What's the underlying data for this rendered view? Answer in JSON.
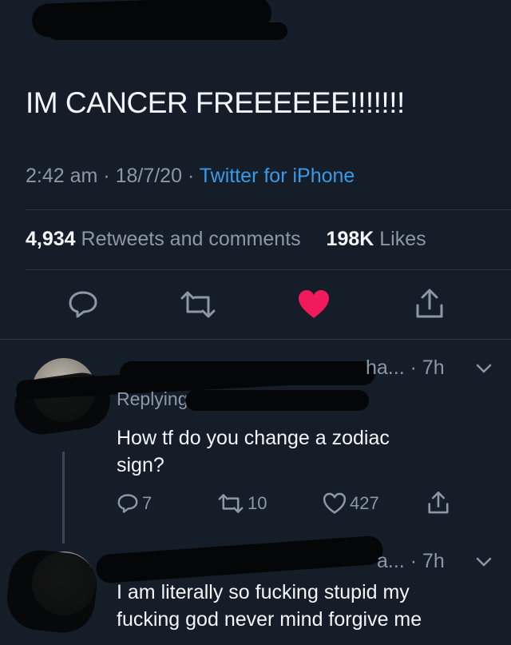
{
  "tweet": {
    "handle_partial": "@…",
    "text": "IM CANCER FREEEEEE!!!!!!!",
    "time": "2:42 am",
    "date": "18/7/20",
    "source": "Twitter for iPhone",
    "retweets_count": "4,934",
    "retweets_label": "Retweets and comments",
    "likes_count": "198K",
    "likes_label": "Likes",
    "liked": true,
    "colors": {
      "link": "#3b9ae8",
      "like": "#f01a5c",
      "muted": "#8a98a7",
      "background": "#151d28"
    }
  },
  "replies": [
    {
      "name_partial": "ha...",
      "age": "· 7h",
      "replying_label": "Replying to",
      "text_line1": "How tf do you change a zodiac",
      "text_line2": "sign?",
      "reply_count": "7",
      "retweet_count": "10",
      "like_count": "427"
    },
    {
      "name_partial": "a...",
      "age": "· 7h",
      "text_line1": "I am literally so fucking stupid my",
      "text_line2": "fucking god never mind forgive me"
    }
  ],
  "icons": [
    "reply-icon",
    "retweet-icon",
    "heart-icon",
    "share-icon",
    "chevron-down-icon"
  ]
}
